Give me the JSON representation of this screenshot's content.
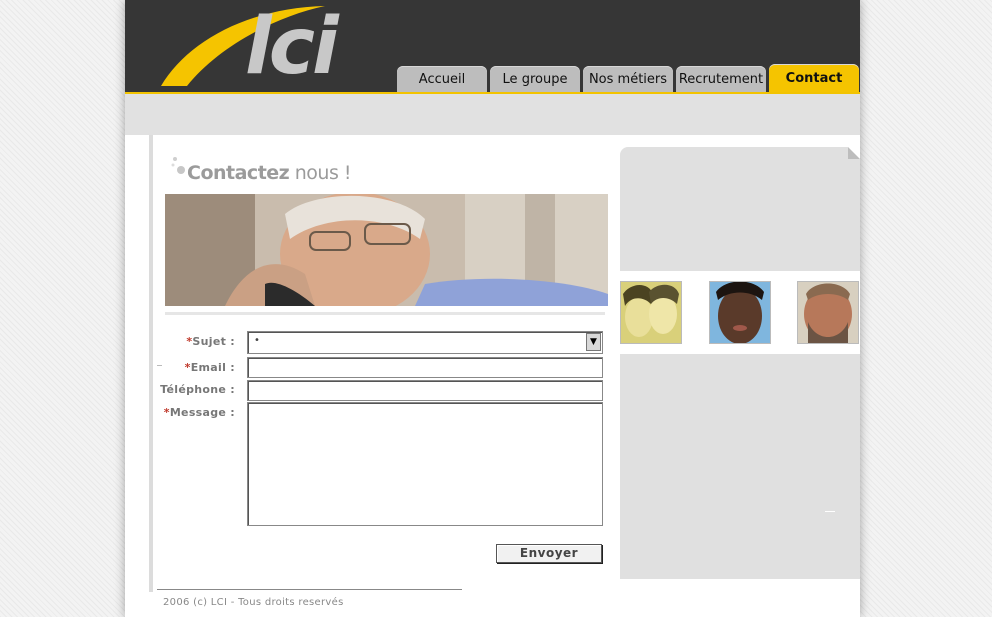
{
  "brand": {
    "logo_text": "lci"
  },
  "nav": {
    "tabs": [
      {
        "label": "Accueil"
      },
      {
        "label": "Le groupe"
      },
      {
        "label": "Nos métiers"
      },
      {
        "label": "Recrutement"
      },
      {
        "label": "Contact"
      }
    ],
    "active": "Contact"
  },
  "page": {
    "title_bold": "Contactez",
    "title_light": " nous !"
  },
  "form": {
    "subject_label": "Sujet :",
    "email_label": "Email :",
    "phone_label": "Téléphone :",
    "message_label": "Message :",
    "required_mark": "*",
    "subject_selected": "•",
    "submit_label": "Envoyer"
  },
  "footer": {
    "copyright": "2006 (c) LCI - Tous droits reservés"
  },
  "colors": {
    "header_bg": "#363636",
    "accent_yellow": "#f5c400",
    "tab_grey": "#bdbdbd",
    "panel_grey": "#e0e0e0"
  },
  "icons": {
    "logo_swoosh": "yellow-swoosh",
    "select_arrow": "chevron-down-icon",
    "title_bullet": "dots-icon"
  }
}
